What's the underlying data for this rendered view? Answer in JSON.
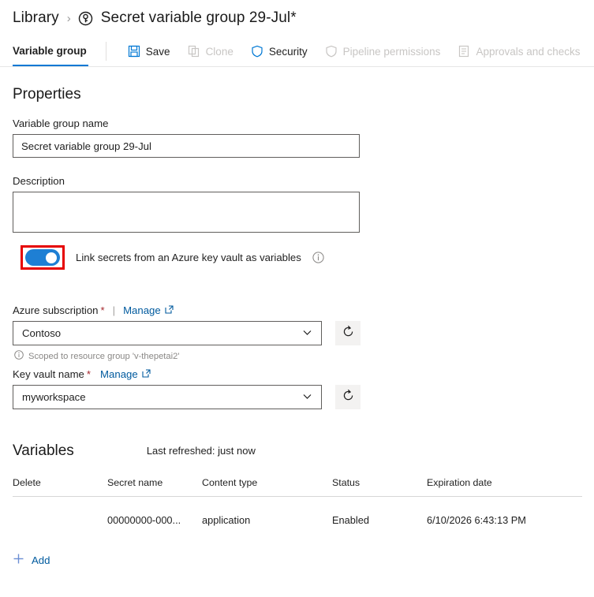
{
  "breadcrumb": {
    "root_label": "Library",
    "separator": "›",
    "icon": "variable-group-icon",
    "title": "Secret variable group 29-Jul*"
  },
  "commandbar": {
    "tab_label": "Variable group",
    "items": [
      {
        "label": "Save",
        "icon": "save-icon",
        "disabled": false
      },
      {
        "label": "Clone",
        "icon": "clone-icon",
        "disabled": true
      },
      {
        "label": "Security",
        "icon": "shield-icon",
        "disabled": false
      },
      {
        "label": "Pipeline permissions",
        "icon": "shield-icon",
        "disabled": true
      },
      {
        "label": "Approvals and checks",
        "icon": "checklist-icon",
        "disabled": true
      }
    ]
  },
  "properties": {
    "section_title": "Properties",
    "name_label": "Variable group name",
    "name_value": "Secret variable group 29-Jul",
    "name_placeholder": "",
    "description_label": "Description",
    "description_value": "",
    "description_placeholder": ""
  },
  "keyvault_toggle": {
    "label": "Link secrets from an Azure key vault as variables",
    "state": "on",
    "info_icon": "info-icon",
    "highlight_color": "#e60000",
    "accent_color": "#1e7fd4"
  },
  "subscription": {
    "label": "Azure subscription",
    "required_marker": "*",
    "divider": "|",
    "manage_label": "Manage",
    "manage_icon": "external-link-icon",
    "selected": "Contoso",
    "chevron": "chevron-down-icon",
    "refresh_icon": "refresh-icon",
    "scoped_note": "Scoped to resource group 'v-thepetai2'",
    "scoped_icon": "info-icon"
  },
  "keyvault": {
    "label": "Key vault name",
    "required_marker": "*",
    "manage_label": "Manage",
    "manage_icon": "external-link-icon",
    "selected": "myworkspace",
    "chevron": "chevron-down-icon",
    "refresh_icon": "refresh-icon"
  },
  "variables": {
    "section_title": "Variables",
    "last_refreshed": "Last refreshed: just now",
    "columns": [
      "Delete",
      "Secret name",
      "Content type",
      "Status",
      "Expiration date"
    ],
    "rows": [
      {
        "delete": "",
        "secret_name": "00000000-000...",
        "content_type": "application",
        "status": "Enabled",
        "expiration_date": "6/10/2026 6:43:13 PM"
      }
    ],
    "add_label": "Add",
    "add_icon": "plus-icon"
  },
  "colors": {
    "accent": "#0078d4",
    "link": "#005a9e",
    "highlight": "#e60000",
    "required": "#a4262c",
    "disabled": "#c8c6c4"
  }
}
